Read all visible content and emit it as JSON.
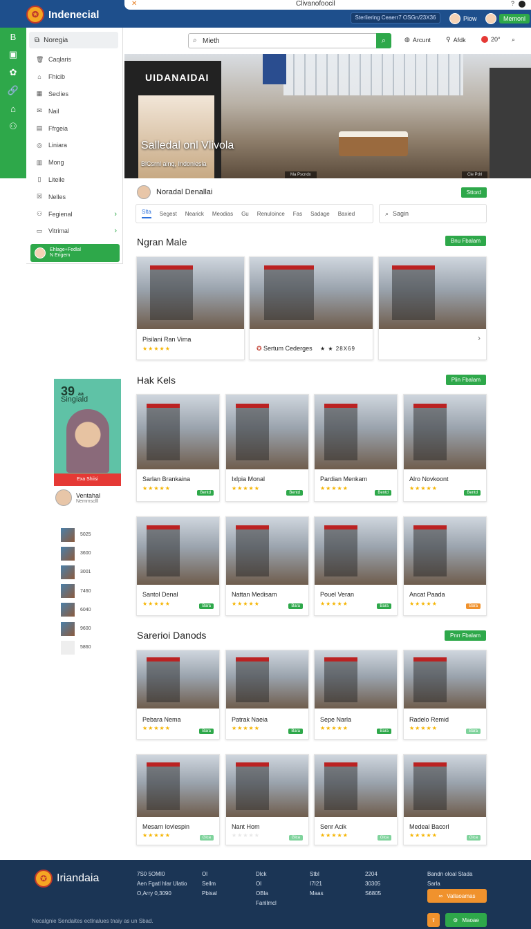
{
  "topbar": {
    "brand": "Indenecial",
    "close_glyph": "✕",
    "url": "Clivanofoocil",
    "question": "?",
    "promo_text": "Sterliering Ceaerr7 OSGn/23X36",
    "user1": "Piow",
    "user2": "Memonl"
  },
  "sidebar": {
    "header": "Noregia",
    "items": [
      {
        "label": "Caqlaris",
        "icon": "trash-icon",
        "glyph": "🗑"
      },
      {
        "label": "Fhicib",
        "icon": "tag-icon",
        "glyph": "⌂"
      },
      {
        "label": "Seclies",
        "icon": "grid-icon",
        "glyph": "▦"
      },
      {
        "label": "Nail",
        "icon": "mail-icon",
        "glyph": "✉"
      },
      {
        "label": "Ffrgeia",
        "icon": "file-icon",
        "glyph": "▤"
      },
      {
        "label": "Liniara",
        "icon": "circle-icon",
        "glyph": "◎"
      },
      {
        "label": "Mong",
        "icon": "chart-icon",
        "glyph": "▥"
      },
      {
        "label": "Liteile",
        "icon": "doc-icon",
        "glyph": "▯"
      },
      {
        "label": "Nelles",
        "icon": "box-icon",
        "glyph": "☒"
      },
      {
        "label": "Fegienal",
        "icon": "people-icon",
        "glyph": "⚇"
      },
      {
        "label": "Vitrimal",
        "icon": "book-icon",
        "glyph": "▭"
      }
    ],
    "active_line1": "Ehlage+Fedlal",
    "active_line2": "N Erigem",
    "rail_icons": [
      "B",
      "▣",
      "✿",
      "🔗",
      "⌂",
      "⚇"
    ]
  },
  "search": {
    "value": "Mieth",
    "tools": [
      "Arcunt",
      "Afdk",
      "20°"
    ]
  },
  "hero": {
    "store_sign": "UIDANAIDAI",
    "title": "Salledal onl Vlivola",
    "subtitle": "BlCsrnl alnq, Indoniesia",
    "cap_left": "Ma Pscndx",
    "cap_right": "Cle Pdrl"
  },
  "profile": {
    "name": "Noradal Denallai",
    "button": "Sttord"
  },
  "tabs": [
    "Slta",
    "Segest",
    "Nearick",
    "Meodias",
    "Gu",
    "Renuloince",
    "Fas",
    "Sadage",
    "Baxied"
  ],
  "search2_placeholder": "Sagin",
  "sections": [
    {
      "title": "Ngran Male",
      "button": "Bnu Fbalam",
      "cards": [
        {
          "name": "Pisilani Ran Vima",
          "stars": "★★★★★"
        },
        {
          "name": "Sertum Cederges",
          "stars": "★ ★ 28X69"
        },
        {
          "name": "",
          "stars": ""
        }
      ]
    },
    {
      "title": "Hak Kels",
      "button": "Plin Fbalam",
      "cards": [
        {
          "name": "Sarlan Brankaina",
          "stars": "★★★★★",
          "tag": "Bentd"
        },
        {
          "name": "Ixlpia Monal",
          "stars": "★★★★★",
          "tag": "Bentd"
        },
        {
          "name": "Pardian Menkam",
          "stars": "★★★★★",
          "tag": "Bentd"
        },
        {
          "name": "Alro Novkoont",
          "stars": "★★★★★",
          "tag": "Bentd"
        },
        {
          "name": "Santol Denal",
          "stars": "★★★★★",
          "tag": "Bara"
        },
        {
          "name": "Nattan Medisam",
          "stars": "★★★★★",
          "tag": "Bara"
        },
        {
          "name": "Pouel Veran",
          "stars": "★★★★★",
          "tag": "Bara"
        },
        {
          "name": "Ancat Paada",
          "stars": "★★★★★",
          "tag": "Bara"
        }
      ]
    },
    {
      "title": "Sarerioi Danods",
      "button": "Pnrr Fbalam",
      "cards": [
        {
          "name": "Pebara Nema",
          "stars": "★★★★★",
          "tag": "Bara"
        },
        {
          "name": "Patrak Naeia",
          "stars": "★★★★★",
          "tag": "Bara"
        },
        {
          "name": "Sepe Narla",
          "stars": "★★★★★",
          "tag": "Bara"
        },
        {
          "name": "Radelo Remid",
          "stars": "★★★★★",
          "tag": "Bara"
        },
        {
          "name": "Mesarn Iovlespin",
          "stars": "★★★★★",
          "tag": "Gica"
        },
        {
          "name": "Nant Hom",
          "stars": "★★★★★",
          "tag": "Gica"
        },
        {
          "name": "Senr Acik",
          "stars": "★★★★★",
          "tag": "Gica"
        },
        {
          "name": "Medeal Bacorl",
          "stars": "★★★★★",
          "tag": "Gica"
        }
      ]
    }
  ],
  "promo": {
    "pct": "39",
    "pct_suffix": "aa",
    "sub": "Singiald",
    "bar": "Exa Shiisi",
    "person_name": "Ventahal",
    "person_sub": "Nemmsclll",
    "thumbs": [
      "5025",
      "3600",
      "3001",
      "7460",
      "6040",
      "9600",
      "5860"
    ]
  },
  "footer": {
    "brand": "Iriandaia",
    "col1": [
      "7S0 5OMI0",
      "Aen Fgatl hlar Ulatio",
      "O,Arry 0,3090"
    ],
    "col2": [
      "Ol",
      "Sellm",
      "Pbisal"
    ],
    "col3": [
      "Dlck",
      "Ol",
      "OBla",
      "Fanllmcl"
    ],
    "col4": [
      "Stbl",
      "I7I21",
      "Maas"
    ],
    "col5": [
      "2204",
      "30305",
      "S6805"
    ],
    "col6_title": "Bandn oloal Stada",
    "col6_sub": "Sarla",
    "btn1": "Vallaoamas",
    "btn2": "Maoae",
    "note": "Necalgnie Sendaites ectlnalues tnaiy as un Sbad."
  }
}
